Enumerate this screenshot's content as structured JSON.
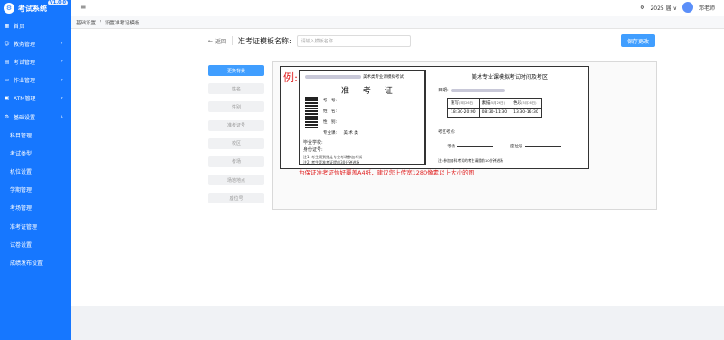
{
  "brand": {
    "title": "考试系统",
    "badge": "V1.0.0"
  },
  "sidebar": {
    "items": [
      {
        "label": "首页",
        "icon": "grid-icon"
      },
      {
        "label": "教务管理",
        "icon": "user-icon",
        "chevron": "∨"
      },
      {
        "label": "考试管理",
        "icon": "file-icon",
        "chevron": "∨"
      },
      {
        "label": "作业管理",
        "icon": "monitor-icon",
        "chevron": "∨"
      },
      {
        "label": "ATM管理",
        "icon": "atm-icon",
        "chevron": "∨"
      },
      {
        "label": "基础设置",
        "icon": "gear-icon",
        "chevron": "∧"
      }
    ],
    "subitems": [
      "科目管理",
      "考试类型",
      "机位设置",
      "学期管理",
      "考场管理",
      "准考证管理",
      "试卷设置",
      "成绩发布设置"
    ]
  },
  "topbar": {
    "menu_icon": "≡",
    "year": "2025 届",
    "caret": "∨",
    "user": "邓老师"
  },
  "breadcrumb": {
    "root": "基础设置",
    "sep": "/",
    "current": "设置准考证模板"
  },
  "header": {
    "back": "返回",
    "template_label": "准考证模板名称:",
    "template_placeholder": "请输入模板名称",
    "save": "保存更改"
  },
  "fields": [
    "更换背景",
    "姓名",
    "性别",
    "准考证号",
    "校区",
    "考场",
    "场地地点",
    "座位号"
  ],
  "ticket": {
    "example": "例:",
    "exam_name": "美术类专业课模拟考试",
    "title": "准 考 证",
    "labels": {
      "no": "考　号:",
      "name": "姓　名:",
      "gender": "性　别:",
      "subject": "专业课:",
      "subject_value": "美 术 类"
    },
    "school": "毕业学校:",
    "id_card": "身份证号:",
    "note1": "注1: 考生须到指定专业考场参加考试",
    "note2": "注2: 考生凭准考证提前30分钟进场",
    "right_title": "美术专业课模拟考试时间及考区",
    "date_label": "日期:",
    "schedule": [
      {
        "name": "速写",
        "day": "(5月26日)",
        "time": "18:30-20:00"
      },
      {
        "name": "素描",
        "day": "(5月26日)",
        "time": "08:30-11:30"
      },
      {
        "name": "色彩",
        "day": "(5月26日)",
        "time": "13:30-16:30"
      }
    ],
    "zone_label": "考区考点:",
    "room_label": "考场",
    "seat_label": "座位号",
    "right_note": "注: 参加各科考试的考生请提前10分钟进场"
  },
  "hint": "为保证准考证恰好覆盖A4纸，建议您上传宽1280像素以上大小的图"
}
